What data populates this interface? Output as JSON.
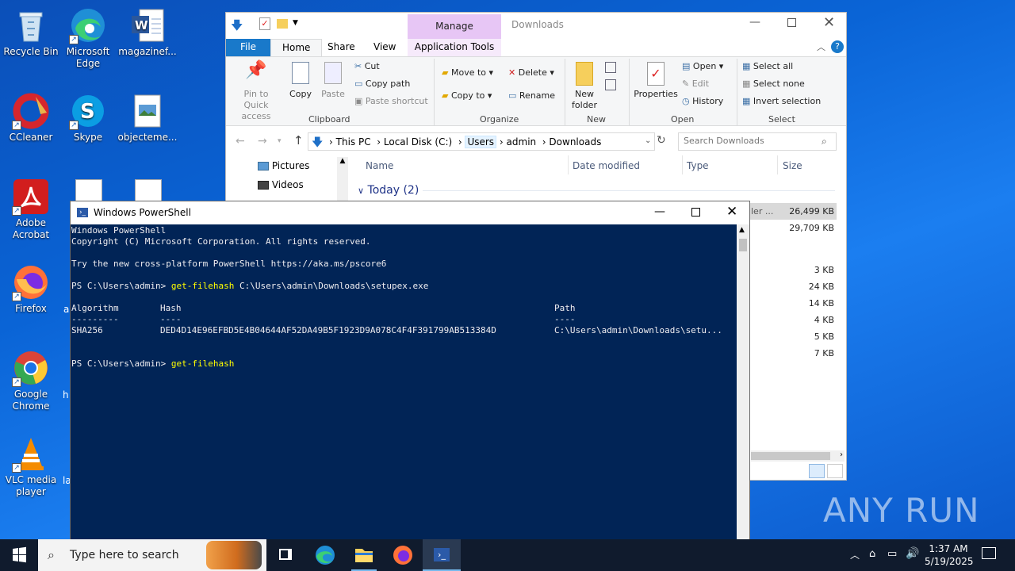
{
  "desktop": {
    "icons": [
      {
        "label": "Recycle Bin"
      },
      {
        "label": "Microsoft Edge"
      },
      {
        "label": "magazinef..."
      },
      {
        "label": "CCleaner"
      },
      {
        "label": "Skype"
      },
      {
        "label": "objecteme..."
      },
      {
        "label": "Adobe Acrobat"
      },
      {
        "label": "Firefox"
      },
      {
        "label": "Google Chrome"
      },
      {
        "label": "VLC media player"
      }
    ],
    "partial_labels": [
      "a",
      "h",
      "la"
    ],
    "watermark": "ANY RUN"
  },
  "explorer": {
    "title": "Downloads",
    "manage_tab": "Manage",
    "tabs": [
      "File",
      "Home",
      "Share",
      "View",
      "Application Tools"
    ],
    "clipboard": {
      "pin": "Pin to Quick access",
      "copy": "Copy",
      "paste": "Paste",
      "cut": "Cut",
      "copy_path": "Copy path",
      "paste_shortcut": "Paste shortcut",
      "label": "Clipboard"
    },
    "organize": {
      "move_to": "Move to",
      "copy_to": "Copy to",
      "delete": "Delete",
      "rename": "Rename",
      "label": "Organize"
    },
    "new": {
      "new_folder": "New folder",
      "label": "New"
    },
    "open": {
      "properties": "Properties",
      "open": "Open",
      "edit": "Edit",
      "history": "History",
      "label": "Open"
    },
    "select": {
      "select_all": "Select all",
      "select_none": "Select none",
      "invert": "Invert selection",
      "label": "Select"
    },
    "breadcrumb": [
      "This PC",
      "Local Disk (C:)",
      "Users",
      "admin",
      "Downloads"
    ],
    "search_placeholder": "Search Downloads",
    "nav_items": [
      "Pictures",
      "Videos"
    ],
    "columns": [
      "Name",
      "Date modified",
      "Type",
      "Size"
    ],
    "group_header": "Today (2)",
    "partial_type": "ler ...",
    "sizes": [
      "26,499 KB",
      "29,709 KB",
      "3 KB",
      "24 KB",
      "14 KB",
      "4 KB",
      "5 KB",
      "7 KB"
    ]
  },
  "powershell": {
    "title": "Windows PowerShell",
    "lines": [
      "Windows PowerShell",
      "Copyright (C) Microsoft Corporation. All rights reserved.",
      "Try the new cross-platform PowerShell https://aka.ms/pscore6"
    ],
    "prompt": "PS C:\\Users\\admin> ",
    "cmd1": "get-filehash",
    "cmd1_arg": " C:\\Users\\admin\\Downloads\\setupex.exe",
    "headers": {
      "algorithm": "Algorithm",
      "hash": "Hash",
      "path": "Path"
    },
    "rule": {
      "algorithm": "---------",
      "hash": "----",
      "path": "----"
    },
    "row": {
      "algorithm": "SHA256",
      "hash": "DED4D14E96EFBD5E4B04644AF52DA49B5F1923D9A078C4F4F391799AB513384D",
      "path": "C:\\Users\\admin\\Downloads\\setu..."
    },
    "cmd2": "get-filehash"
  },
  "taskbar": {
    "search_placeholder": "Type here to search",
    "time": "1:37 AM",
    "date": "5/19/2025"
  },
  "colors": {
    "ps_background": "#012456",
    "ps_text": "#eeedf0",
    "ps_command": "#ffff00",
    "manage_tab": "#e7c6f5",
    "file_tab": "#1979ca",
    "taskbar": "#101b2d"
  }
}
